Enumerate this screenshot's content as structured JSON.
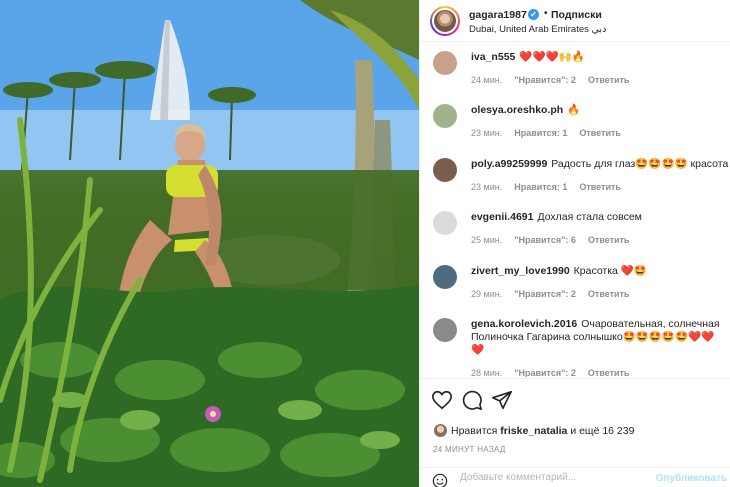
{
  "header": {
    "username": "gagara1987",
    "verified_mark": "✔",
    "separator": "•",
    "follow_label": "Подписки",
    "location": "Dubai, United Arab Emirates دبي"
  },
  "comments": [
    {
      "user": "iva_n555",
      "text": "❤️❤️❤️🙌🔥",
      "age": "24 мин.",
      "likes": "\"Нравится\": 2",
      "reply": "Ответить",
      "avatar_color": "#c9a08a"
    },
    {
      "user": "olesya.oreshko.ph",
      "text": "🔥",
      "age": "23 мин.",
      "likes": "Нравится: 1",
      "reply": "Ответить",
      "avatar_color": "#9fb48a"
    },
    {
      "user": "poly.a99259999",
      "text": "Радость для глаз🤩🤩🤩🤩 красота",
      "age": "23 мин.",
      "likes": "Нравится: 1",
      "reply": "Ответить",
      "avatar_color": "#7a5e4b"
    },
    {
      "user": "evgenii.4691",
      "text": "Дохлая стала совсем",
      "age": "25 мин.",
      "likes": "\"Нравится\": 6",
      "reply": "Ответить",
      "avatar_color": "#dbdbdb"
    },
    {
      "user": "zivert_my_love1990",
      "text": "Красотка ❤️🤩",
      "age": "29 мин.",
      "likes": "\"Нравится\": 2",
      "reply": "Ответить",
      "avatar_color": "#4f6b7e"
    },
    {
      "user": "gena.korolevich.2016",
      "text": "Очаровательная, солнечная Полиночка Гагарина солнышко🤩🤩🤩🤩🤩❤️❤️❤️",
      "age": "28 мин.",
      "likes": "\"Нравится\": 2",
      "reply": "Ответить",
      "avatar_color": "#8a8a8a"
    }
  ],
  "likes": {
    "prefix": "Нравится",
    "user": "friske_natalia",
    "suffix": "и ещё 16 239"
  },
  "time_label": "24 МИНУТ НАЗАД",
  "add_comment": {
    "placeholder": "Добавьте комментарий...",
    "post_label": "Опубликовать"
  },
  "icons": {
    "like": "heart-icon",
    "comment": "comment-bubble-icon",
    "share": "paper-plane-icon",
    "emoji": "smile-icon"
  },
  "colors": {
    "text": "#262626",
    "muted": "#8e8e8e",
    "verified": "#3897f0",
    "heart": "#ed4956"
  }
}
